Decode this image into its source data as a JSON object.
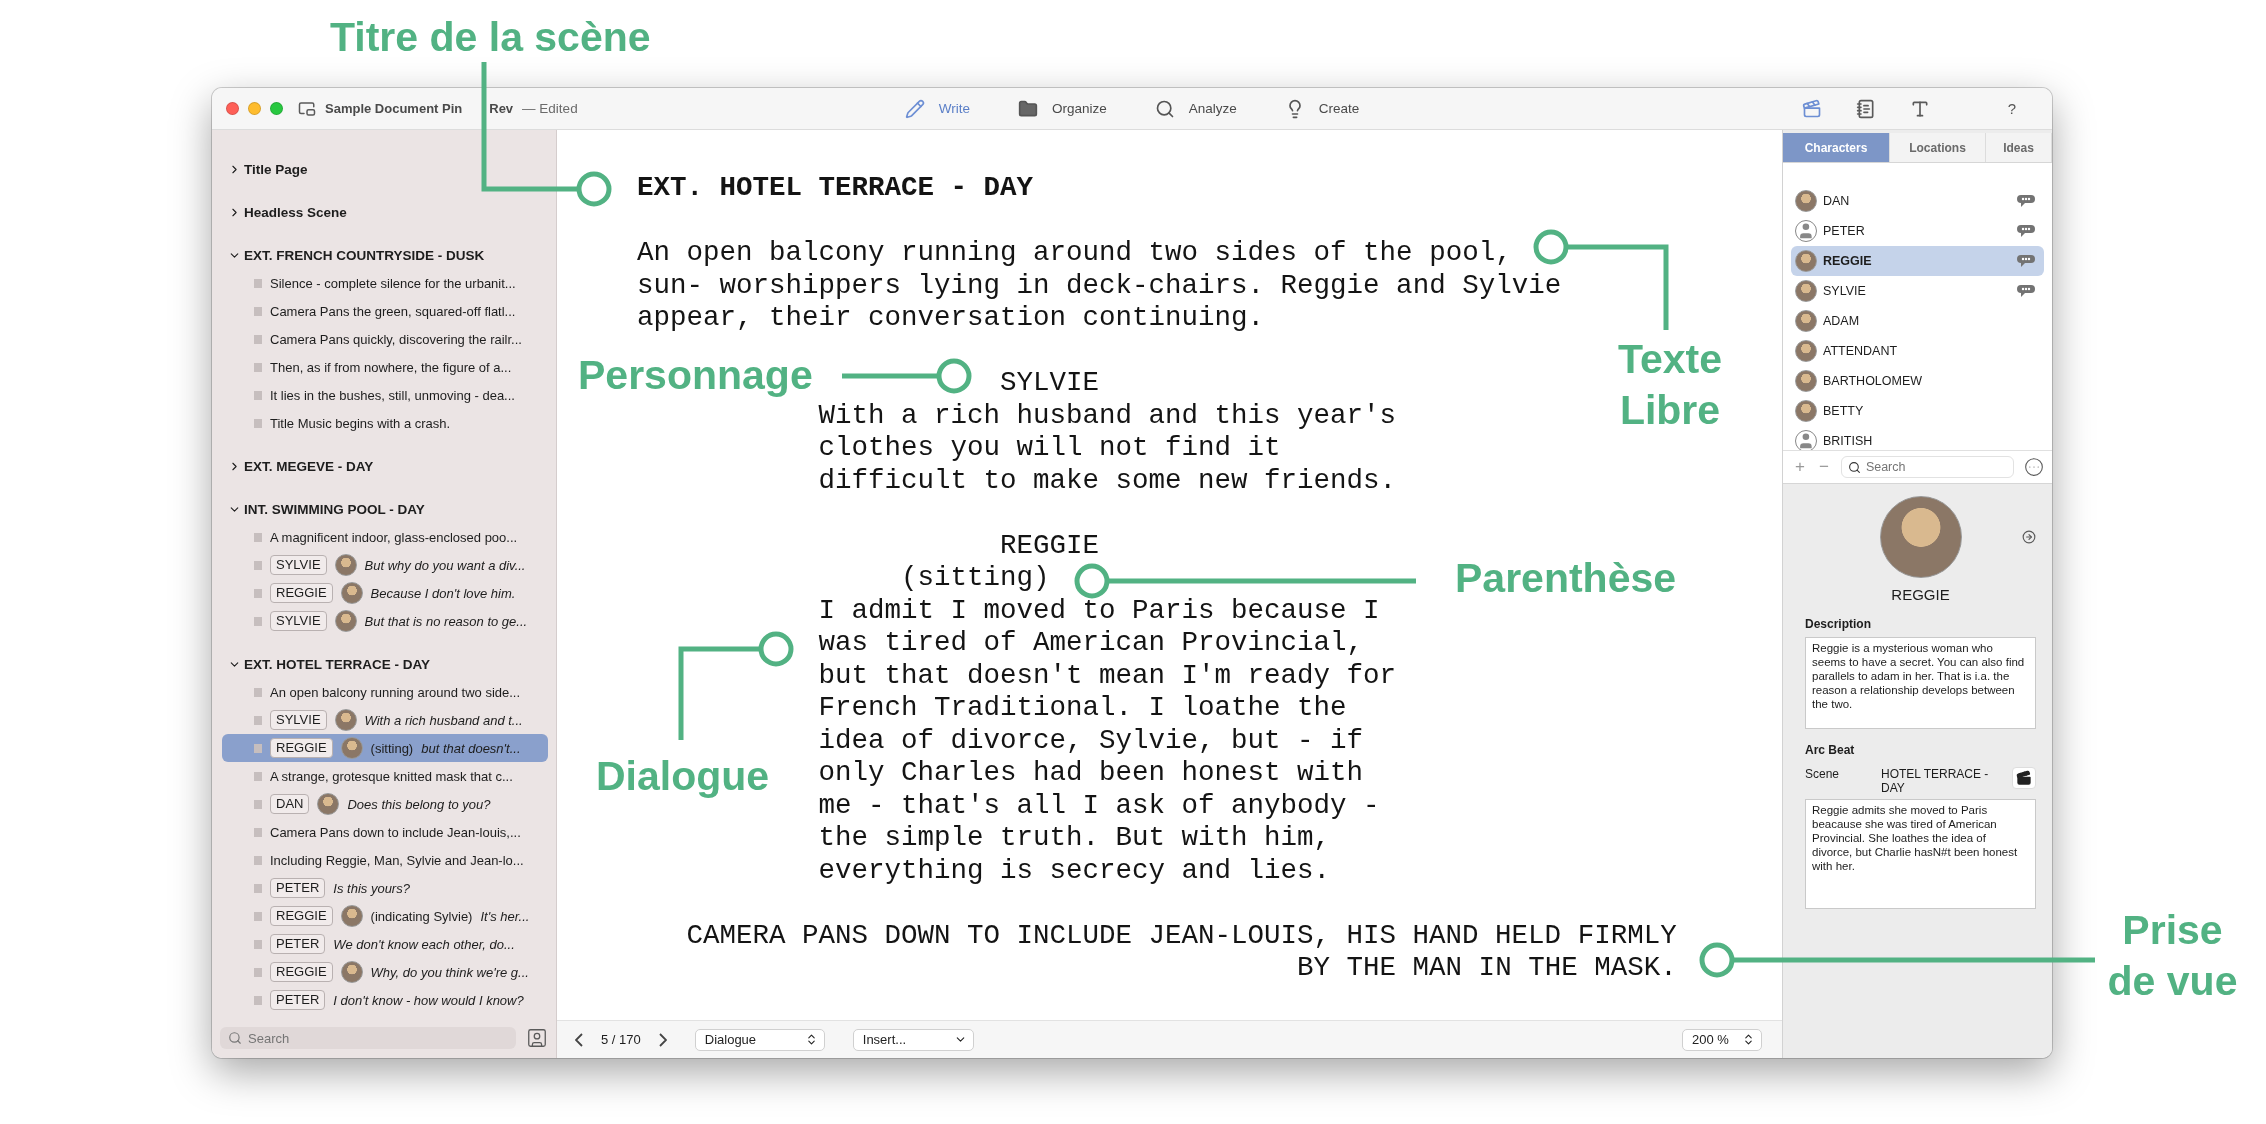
{
  "window": {
    "title_parts": [
      "Sample Document Pin",
      "Rev"
    ],
    "status": "— Edited"
  },
  "toolbar": {
    "modes": [
      {
        "label": "Write",
        "selected": true
      },
      {
        "label": "Organize",
        "selected": false
      },
      {
        "label": "Analyze",
        "selected": false
      },
      {
        "label": "Create",
        "selected": false
      }
    ],
    "help": "?"
  },
  "outline": [
    {
      "title": "Title Page",
      "expanded": false
    },
    {
      "title": "Headless Scene",
      "expanded": false
    },
    {
      "title": "EXT. FRENCH COUNTRYSIDE - DUSK",
      "expanded": true,
      "children": [
        {
          "kind": "action",
          "text": "Silence - complete silence for the urbanit...",
          "selected": false
        },
        {
          "kind": "action",
          "text": "Camera Pans the green, squared-off flatl...",
          "selected": false
        },
        {
          "kind": "action",
          "text": "Camera Pans quickly, discovering the railr...",
          "selected": false
        },
        {
          "kind": "action",
          "text": "Then, as if from nowhere, the figure of a...",
          "selected": false
        },
        {
          "kind": "action",
          "text": "It lies in the bushes, still, unmoving - dea...",
          "selected": false
        },
        {
          "kind": "action",
          "text": "Title Music begins with a crash.",
          "selected": false
        }
      ]
    },
    {
      "title": "EXT. MEGEVE - DAY",
      "expanded": false
    },
    {
      "title": "INT. SWIMMING POOL - DAY",
      "expanded": true,
      "children": [
        {
          "kind": "action",
          "text": "A magnificent indoor, glass-enclosed poo...",
          "selected": false
        },
        {
          "kind": "dialogue",
          "character": "SYLVIE",
          "avatar": true,
          "text": "But why do you want a div...",
          "selected": false
        },
        {
          "kind": "dialogue",
          "character": "REGGIE",
          "avatar": true,
          "text": "Because I don't love him.",
          "selected": false
        },
        {
          "kind": "dialogue",
          "character": "SYLVIE",
          "avatar": true,
          "text": "But that is no reason to ge...",
          "selected": false
        }
      ]
    },
    {
      "title": "EXT. HOTEL TERRACE - DAY",
      "expanded": true,
      "children": [
        {
          "kind": "action",
          "text": "An open balcony running around two side...",
          "selected": false
        },
        {
          "kind": "dialogue",
          "character": "SYLVIE",
          "avatar": true,
          "text": "With a rich husband and t...",
          "selected": false
        },
        {
          "kind": "dialogue",
          "character": "REGGIE",
          "avatar": true,
          "parenthetical": "(sitting)",
          "text": "but that doesn't...",
          "selected": true
        },
        {
          "kind": "action",
          "text": "A strange, grotesque knitted mask that c...",
          "selected": false
        },
        {
          "kind": "dialogue",
          "character": "DAN",
          "avatar": true,
          "text": "Does this belong to you?",
          "selected": false
        },
        {
          "kind": "action",
          "text": "Camera Pans down to include Jean-louis,...",
          "selected": false
        },
        {
          "kind": "action",
          "text": "Including Reggie, Man, Sylvie and Jean-lo...",
          "selected": false
        },
        {
          "kind": "dialogue",
          "character": "PETER",
          "avatar": false,
          "text": "Is this yours?",
          "selected": false
        },
        {
          "kind": "dialogue",
          "character": "REGGIE",
          "avatar": true,
          "parenthetical": "(indicating Sylvie)",
          "text": "It's her...",
          "selected": false
        },
        {
          "kind": "dialogue",
          "character": "PETER",
          "avatar": false,
          "text": "We don't know each other, do...",
          "selected": false
        },
        {
          "kind": "dialogue",
          "character": "REGGIE",
          "avatar": true,
          "text": "Why, do you think we're g...",
          "selected": false
        },
        {
          "kind": "dialogue",
          "character": "PETER",
          "avatar": false,
          "text": "I don't know - how would I know?",
          "selected": false
        }
      ]
    }
  ],
  "sidebar_search": {
    "placeholder": "Search"
  },
  "script": [
    {
      "kind": "heading",
      "text": "EXT. HOTEL TERRACE - DAY"
    },
    {
      "kind": "action",
      "text": "An open balcony running around two sides of the pool, sun- worshippers lying in deck-chairs. Reggie and Sylvie appear, their conversation continuing."
    },
    {
      "kind": "character",
      "text": "SYLVIE"
    },
    {
      "kind": "dialogue",
      "text": "With a rich husband and this year's clothes you will not find it difficult to make some new friends."
    },
    {
      "kind": "character",
      "text": "REGGIE"
    },
    {
      "kind": "parenthetical",
      "text": "(sitting)"
    },
    {
      "kind": "dialogue",
      "text": "I admit I moved to Paris because I was tired of American Provincial, but that doesn't mean I'm ready for French Traditional. I loathe the idea of divorce, Sylvie, but - if only Charles had been honest with me - that's all I ask of anybody - the simple truth. But with him, everything is secrecy and lies."
    },
    {
      "kind": "shot",
      "text": "CAMERA PANS DOWN TO INCLUDE JEAN-LOUIS, HIS HAND HELD FIRMLY BY THE MAN IN THE MASK."
    }
  ],
  "editor_footer": {
    "page": "5 / 170",
    "element_type": "Dialogue",
    "insert": "Insert...",
    "zoom": "200 %"
  },
  "panel": {
    "tabs": [
      {
        "label": "Characters",
        "selected": true
      },
      {
        "label": "Locations",
        "selected": false
      },
      {
        "label": "Ideas",
        "selected": false
      }
    ],
    "characters": [
      {
        "name": "DAN",
        "kind": "photo",
        "notes": true,
        "selected": false
      },
      {
        "name": "PETER",
        "kind": "silhouette",
        "notes": true,
        "selected": false
      },
      {
        "name": "REGGIE",
        "kind": "photo",
        "notes": true,
        "selected": true
      },
      {
        "name": "SYLVIE",
        "kind": "photo",
        "notes": true,
        "selected": false
      },
      {
        "name": "ADAM",
        "kind": "photo",
        "notes": false,
        "selected": false
      },
      {
        "name": "ATTENDANT",
        "kind": "photo",
        "notes": false,
        "selected": false
      },
      {
        "name": "BARTHOLOMEW",
        "kind": "photo",
        "notes": false,
        "selected": false
      },
      {
        "name": "BETTY",
        "kind": "photo",
        "notes": false,
        "selected": false
      },
      {
        "name": "BRITISH",
        "kind": "silhouette",
        "notes": false,
        "selected": false
      }
    ],
    "add": "+",
    "remove": "−",
    "search": {
      "placeholder": "Search"
    },
    "detail": {
      "name": "REGGIE",
      "description_label": "Description",
      "description": "Reggie is a mysterious woman who seems to have a secret. You can also find parallels to adam in her. That is i.a. the reason a relationship develops between the two.",
      "arc_label": "Arc Beat",
      "scene_label": "Scene",
      "scene": "HOTEL TERRACE - DAY",
      "arc_text": "Reggie admits she moved to Paris beacause she was tired of American Provincial. She loathes the idea of divorce, but Charlie hasN#t been honest with her."
    }
  },
  "annotations": [
    {
      "text": "Titre de la scène"
    },
    {
      "text": "Personnage"
    },
    {
      "text": "Texte Libre"
    },
    {
      "text": "Parenthèse"
    },
    {
      "text": "Dialogue"
    },
    {
      "text": "Prise de vue"
    }
  ]
}
